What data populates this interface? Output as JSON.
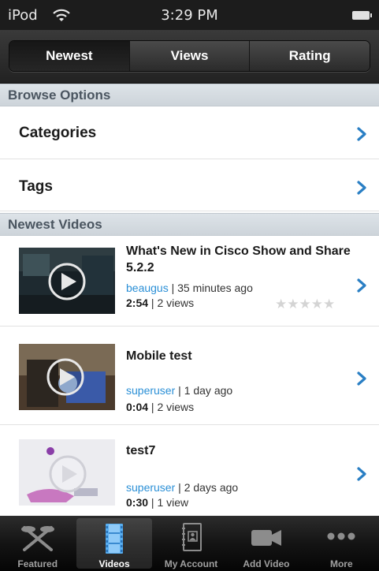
{
  "status_bar": {
    "carrier": "iPod",
    "time": "3:29 PM"
  },
  "segments": [
    {
      "label": "Newest",
      "active": true
    },
    {
      "label": "Views",
      "active": false
    },
    {
      "label": "Rating",
      "active": false
    }
  ],
  "browse": {
    "header": "Browse Options",
    "items": [
      {
        "label": "Categories"
      },
      {
        "label": "Tags"
      }
    ]
  },
  "newest": {
    "header": "Newest Videos",
    "videos": [
      {
        "title": "What's New in Cisco Show and Share 5.2.2",
        "user": "beaugus",
        "age": "35 minutes ago",
        "duration": "2:54",
        "views": "2 views",
        "rating": 0
      },
      {
        "title": "Mobile test",
        "user": "superuser",
        "age": "1 day ago",
        "duration": "0:04",
        "views": "2 views"
      },
      {
        "title": "test7",
        "user": "superuser",
        "age": "2 days ago",
        "duration": "0:30",
        "views": "1 view"
      }
    ]
  },
  "tabs": [
    {
      "label": "Featured",
      "icon": "featured-icon",
      "active": false
    },
    {
      "label": "Videos",
      "icon": "film-icon",
      "active": true
    },
    {
      "label": "My Account",
      "icon": "address-book-icon",
      "active": false
    },
    {
      "label": "Add Video",
      "icon": "video-camera-icon",
      "active": false
    },
    {
      "label": "More",
      "icon": "more-dots-icon",
      "active": false
    }
  ],
  "colors": {
    "link": "#2a8fd6",
    "chevron": "#2a7fc4",
    "section_header_text": "#4a5560"
  }
}
